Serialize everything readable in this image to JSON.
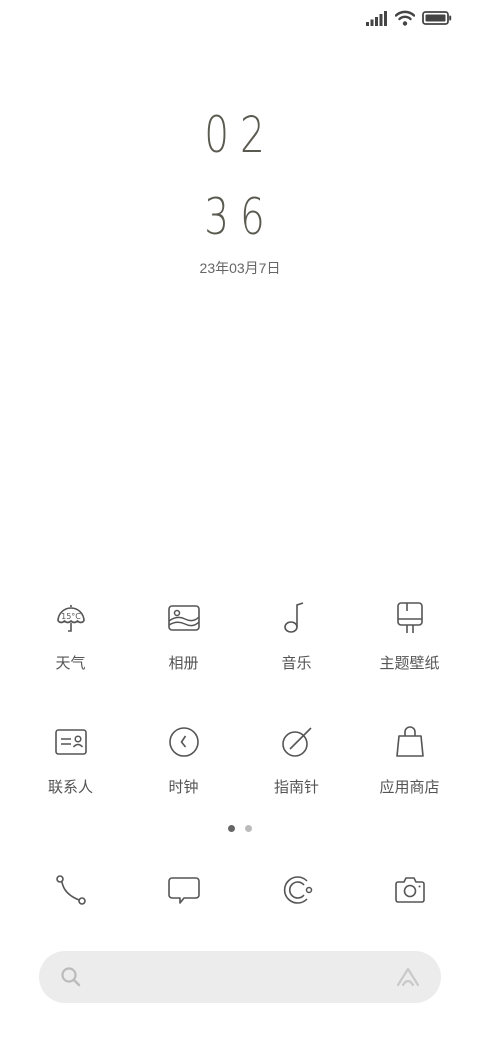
{
  "status_bar": {
    "icons": [
      "signal-icon",
      "wifi-icon",
      "battery-icon"
    ]
  },
  "clock": {
    "hour": "02",
    "minute": "36",
    "date": "23年03月7日"
  },
  "apps": [
    {
      "label": "天气",
      "icon": "weather-icon",
      "temp": "15°C"
    },
    {
      "label": "相册",
      "icon": "gallery-icon"
    },
    {
      "label": "音乐",
      "icon": "music-icon"
    },
    {
      "label": "主题壁纸",
      "icon": "theme-icon"
    },
    {
      "label": "联系人",
      "icon": "contacts-icon"
    },
    {
      "label": "时钟",
      "icon": "clock-icon"
    },
    {
      "label": "指南针",
      "icon": "compass-icon"
    },
    {
      "label": "应用商店",
      "icon": "app-store-icon"
    }
  ],
  "page_indicator": {
    "pages": 2,
    "active": 0
  },
  "dock": [
    "phone-icon",
    "messages-icon",
    "browser-icon",
    "camera-icon"
  ],
  "search_bar": {
    "icons": [
      "search-icon",
      "assistant-icon"
    ]
  }
}
